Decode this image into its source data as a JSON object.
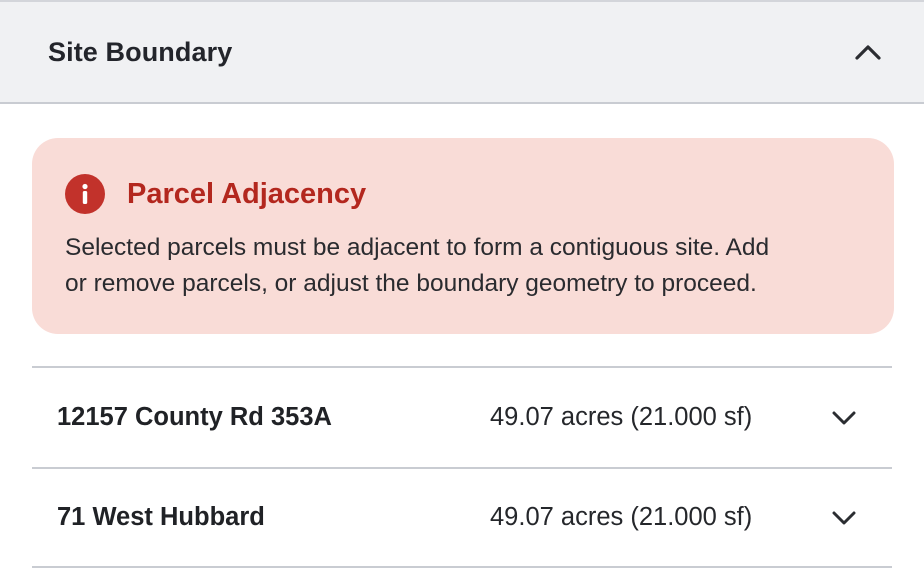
{
  "section": {
    "title": "Site Boundary",
    "collapse_icon": "chevron-up-icon"
  },
  "alert": {
    "icon": "info-icon",
    "icon_glyph": "i",
    "title": "Parcel Adjacency",
    "message_line1": "Selected parcels must be adjacent to form a contiguous site. Add",
    "message_line2": "or remove parcels, or adjust the boundary geometry to proceed.",
    "colors": {
      "background": "#f9dcd7",
      "accent": "#b3271e"
    }
  },
  "parcels": [
    {
      "address": "12157 County Rd 353A",
      "area": "49.07 acres (21.000 sf)",
      "expand_icon": "chevron-down-icon"
    },
    {
      "address": "71 West Hubbard",
      "area": "49.07 acres (21.000 sf)",
      "expand_icon": "chevron-down-icon"
    }
  ]
}
